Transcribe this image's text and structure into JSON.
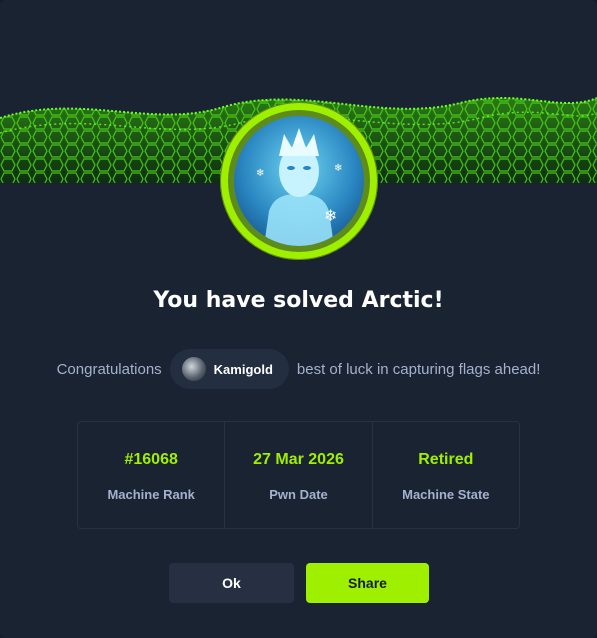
{
  "title": "You have solved Arctic!",
  "congrats": {
    "prefix": "Congratulations",
    "username": "Kamigold",
    "suffix": "best of luck in capturing flags ahead!"
  },
  "stats": [
    {
      "value": "#16068",
      "label": "Machine Rank"
    },
    {
      "value": "27 Mar 2026",
      "label": "Pwn Date"
    },
    {
      "value": "Retired",
      "label": "Machine State"
    }
  ],
  "buttons": {
    "ok": "Ok",
    "share": "Share"
  },
  "colors": {
    "accent": "#9fef00",
    "background": "#1a2332",
    "muted_text": "#a4b1cd"
  }
}
